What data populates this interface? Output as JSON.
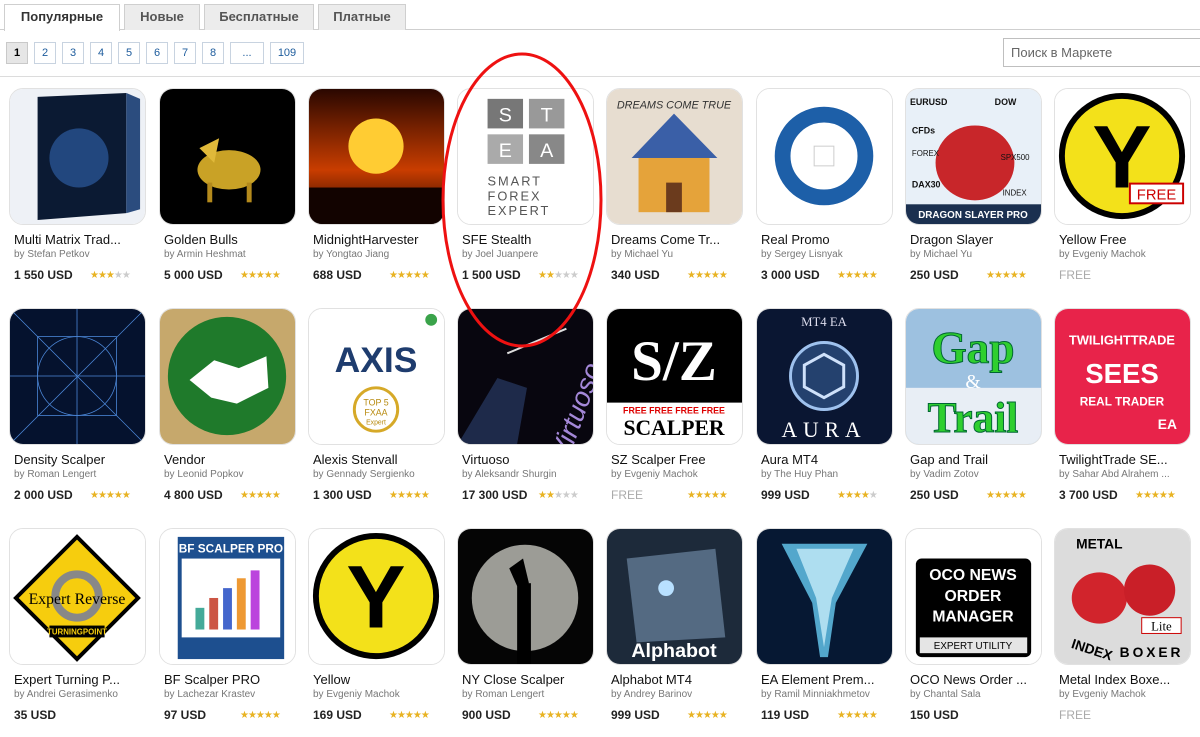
{
  "tabs": [
    "Популярные",
    "Новые",
    "Бесплатные",
    "Платные"
  ],
  "pager": {
    "pages": [
      "1",
      "2",
      "3",
      "4",
      "5",
      "6",
      "7",
      "8",
      "...",
      "109"
    ],
    "current": "1"
  },
  "search": {
    "placeholder": "Поиск в Маркете"
  },
  "products": [
    {
      "name": "Multi Matrix Trad...",
      "author": "by Stefan Petkov",
      "price": "1 550 USD",
      "rating": 3,
      "icon": "box-icon"
    },
    {
      "name": "Golden Bulls",
      "author": "by Armin Heshmat",
      "price": "5 000 USD",
      "rating": 5,
      "icon": "bull-icon"
    },
    {
      "name": "MidnightHarvester",
      "author": "by Yongtao Jiang",
      "price": "688 USD",
      "rating": 5,
      "icon": "sunset-icon"
    },
    {
      "name": "SFE Stealth",
      "author": "by Joel Juanpere",
      "price": "1 500 USD",
      "rating": 2,
      "icon": "stea-logo-icon",
      "logo_text": [
        "S",
        "T",
        "E",
        "A"
      ],
      "logo_caption": [
        "SMART",
        "FOREX",
        "EXPERT"
      ]
    },
    {
      "name": "Dreams Come Tr...",
      "author": "by Michael Yu",
      "price": "340 USD",
      "rating": 5,
      "icon": "house-icon",
      "logo_text": "DREAMS COME TRUE"
    },
    {
      "name": "Real Promo",
      "author": "by Sergey Lisnyak",
      "price": "3 000 USD",
      "rating": 5,
      "icon": "ring-icon"
    },
    {
      "name": "Dragon Slayer",
      "author": "by Michael Yu",
      "price": "250 USD",
      "rating": 5,
      "icon": "dragon-icon",
      "logo_text": [
        "EURUSD",
        "DOW",
        "CFDs",
        "FOREX",
        "SPX500",
        "DAX30",
        "INDEX",
        "DRAGON SLAYER PRO"
      ]
    },
    {
      "name": "Yellow Free",
      "author": "by Evgeniy Machok",
      "price": "FREE",
      "rating": 0,
      "icon": "yellow-y-free-icon",
      "logo_text": [
        "Y",
        "FREE"
      ]
    },
    {
      "name": "Density Scalper",
      "author": "by Roman Lengert",
      "price": "2 000 USD",
      "rating": 5,
      "icon": "grid-lines-icon"
    },
    {
      "name": "Vendor",
      "author": "by Leonid Popkov",
      "price": "4 800 USD",
      "rating": 5,
      "icon": "handshake-icon"
    },
    {
      "name": "Alexis Stenvall",
      "author": "by Gennady Sergienko",
      "price": "1 300 USD",
      "rating": 5,
      "icon": "axis-logo-icon",
      "logo_text": [
        "AXIS",
        "TOP 5",
        "FXAA",
        "Expert"
      ]
    },
    {
      "name": "Virtuoso",
      "author": "by Aleksandr Shurgin",
      "price": "17 300 USD",
      "rating": 2,
      "icon": "conductor-icon",
      "logo_text": "Virtuoso"
    },
    {
      "name": "SZ Scalper Free",
      "author": "by Evgeniy Machok",
      "price": "FREE",
      "rating": 5,
      "icon": "sz-logo-icon",
      "logo_text": [
        "S/Z",
        "FREE",
        "SCALPER"
      ]
    },
    {
      "name": "Aura MT4",
      "author": "by The Huy Phan",
      "price": "999 USD",
      "rating": 4,
      "icon": "aura-logo-icon",
      "logo_text": [
        "MT4 EA",
        "AURA"
      ]
    },
    {
      "name": "Gap and Trail",
      "author": "by Vadim Zotov",
      "price": "250 USD",
      "rating": 5,
      "icon": "gap-trail-icon",
      "logo_text": [
        "Gap",
        "&",
        "Trail"
      ]
    },
    {
      "name": "TwilightTrade SE...",
      "author": "by Sahar Abd Alrahem ...",
      "price": "3 700 USD",
      "rating": 5,
      "icon": "twilight-icon",
      "logo_text": [
        "TWILIGHTTRADE",
        "SEES",
        "REAL TRADER",
        "EA"
      ]
    },
    {
      "name": "Expert Turning P...",
      "author": "by Andrei Gerasimenko",
      "price": "35 USD",
      "rating": 0,
      "icon": "expert-reverse-icon",
      "logo_text": [
        "Expert Reverse",
        "TURNINGPOINT"
      ]
    },
    {
      "name": "BF Scalper PRO",
      "author": "by Lachezar Krastev",
      "price": "97 USD",
      "rating": 5,
      "icon": "bf-box-icon",
      "logo_text": [
        "BF SCALPER PRO"
      ]
    },
    {
      "name": "Yellow",
      "author": "by Evgeniy Machok",
      "price": "169 USD",
      "rating": 5,
      "icon": "yellow-y-icon",
      "logo_text": [
        "Y"
      ]
    },
    {
      "name": "NY Close Scalper",
      "author": "by Roman Lengert",
      "price": "900 USD",
      "rating": 5,
      "icon": "liberty-moon-icon"
    },
    {
      "name": "Alphabot MT4",
      "author": "by Andrey Barinov",
      "price": "999 USD",
      "rating": 5,
      "icon": "robot-head-icon",
      "logo_text": [
        "Alphabot"
      ]
    },
    {
      "name": "EA Element Prem...",
      "author": "by Ramil Minniakhmetov",
      "price": "119 USD",
      "rating": 5,
      "icon": "tornado-icon"
    },
    {
      "name": "OCO News Order ...",
      "author": "by Chantal Sala",
      "price": "150 USD",
      "rating": 0,
      "icon": "oco-news-icon",
      "logo_text": [
        "OCO NEWS",
        "ORDER",
        "MANAGER",
        "EXPERT UTILITY"
      ]
    },
    {
      "name": "Metal Index Boxe...",
      "author": "by Evgeniy Machok",
      "price": "FREE",
      "rating": 0,
      "icon": "boxing-gloves-icon",
      "logo_text": [
        "METAL",
        "INDEX",
        "BOXER",
        "Lite"
      ]
    }
  ]
}
